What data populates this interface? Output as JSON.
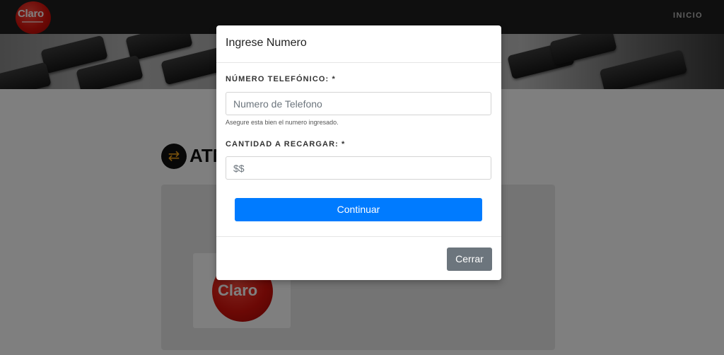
{
  "nav": {
    "logo_text": "Claro",
    "link_inicio": "INICIO"
  },
  "page": {
    "section_title": "ATM",
    "card_logo_text": "Claro"
  },
  "modal": {
    "title": "Ingrese Numero",
    "phone_label": "NÚMERO TELEFÓNICO: *",
    "phone_placeholder": "Numero de Telefono",
    "phone_help": "Asegure esta bien el numero ingresado.",
    "amount_label": "CANTIDAD A RECARGAR: *",
    "amount_placeholder": "$$",
    "continue_label": "Continuar",
    "close_label": "Cerrar"
  },
  "colors": {
    "primary": "#007bff",
    "secondary": "#6c757d",
    "brand_red": "#d8120b"
  }
}
